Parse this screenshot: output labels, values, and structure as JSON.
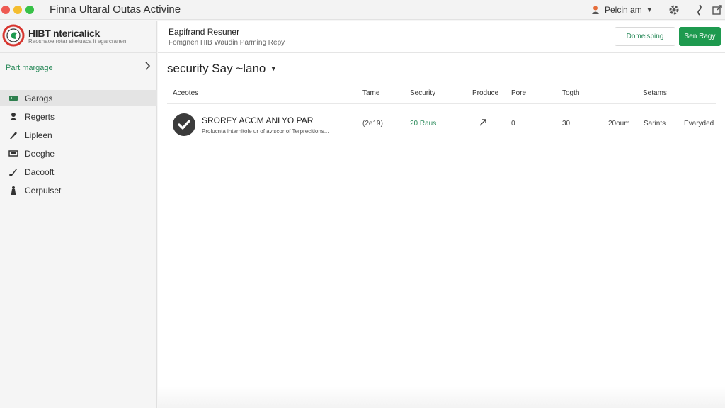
{
  "window": {
    "title": "Finna Ultaral Outas Activine"
  },
  "user": {
    "name": "Pelcin am"
  },
  "brand": {
    "name": "HIBT ntericalick",
    "subtitle": "Raosnaoe rotar sitetuaca it egarcranen"
  },
  "sidebar": {
    "part_label": "Part margage",
    "items": [
      {
        "label": "Garogs",
        "icon": "server-icon",
        "selected": true
      },
      {
        "label": "Regerts",
        "icon": "user-icon",
        "selected": false
      },
      {
        "label": "Lipleen",
        "icon": "pen-icon",
        "selected": false
      },
      {
        "label": "Deeghe",
        "icon": "monitor-icon",
        "selected": false
      },
      {
        "label": "Dacooft",
        "icon": "brush-icon",
        "selected": false
      },
      {
        "label": "Cerpulset",
        "icon": "chess-icon",
        "selected": false
      }
    ]
  },
  "header": {
    "title": "Eapifrand Resuner",
    "subtitle": "Fomgnen HIB Waudin Parming Repy",
    "secondary_button": "Domeisping",
    "primary_button": "Sen Ragy"
  },
  "view": {
    "title": "security Say ~lano"
  },
  "table": {
    "columns": [
      "Aceotes",
      "Tame",
      "Security",
      "Produce",
      "Pore",
      "Togth",
      "Setams"
    ],
    "rows": [
      {
        "title": "SRORFY ACCM ANLYO PAR",
        "description": "Prolucnta intarnitole ur of aviscor of Terprecitions...",
        "time": "(2e19)",
        "security": "20 Raus",
        "pore": "0",
        "togth": "30",
        "size": "20oum",
        "setams": "Sarints",
        "status": "Evaryded"
      }
    ]
  },
  "colors": {
    "accent": "#1e9a4f",
    "link": "#2a8a5a",
    "brand_red": "#d7352f"
  }
}
